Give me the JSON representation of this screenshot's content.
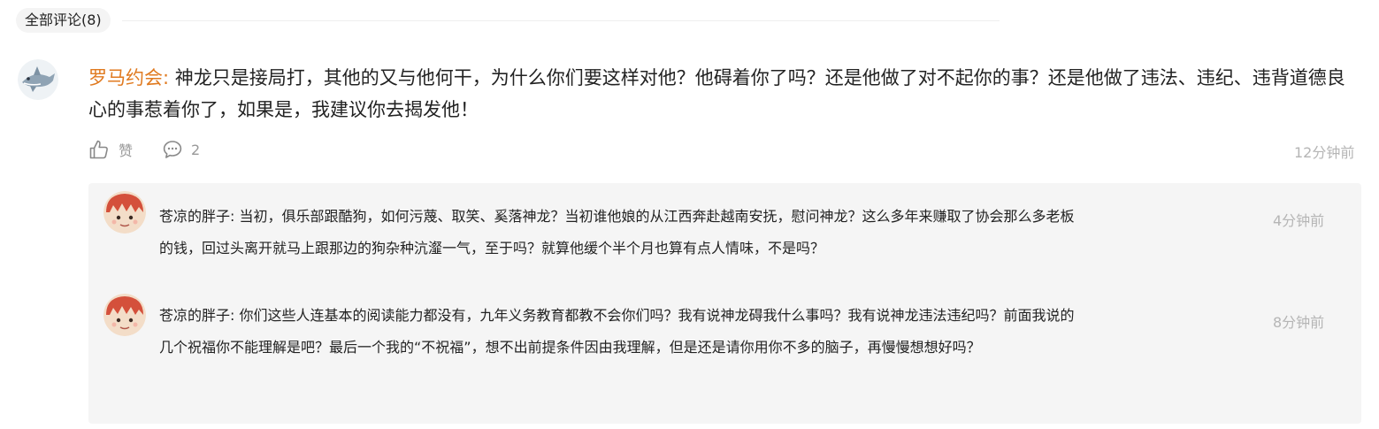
{
  "header": {
    "tab_label": "全部评论(8)"
  },
  "comment": {
    "author": "罗马约会",
    "separator": ": ",
    "text": "神龙只是接局打，其他的又与他何干，为什么你们要这样对他？他碍着你了吗？还是他做了对不起你的事？还是他做了违法、违纪、违背道德良心的事惹着你了，如果是，我建议你去揭发他！",
    "like_label": "赞",
    "reply_count": "2",
    "time": "12分钟前"
  },
  "replies": [
    {
      "author": "苍凉的胖子",
      "separator": ": ",
      "text": "当初，俱乐部跟酷狗，如何污蔑、取笑、奚落神龙？当初谁他娘的从江西奔赴越南安抚，慰问神龙？这么多年来赚取了协会那么多老板的钱，回过头离开就马上跟那边的狗杂种沆瀣一气，至于吗？就算他缓个半个月也算有点人情味，不是吗？",
      "time": "4分钟前"
    },
    {
      "author": "苍凉的胖子",
      "separator": ": ",
      "text": "你们这些人连基本的阅读能力都没有，九年义务教育都教不会你们吗？我有说神龙碍我什么事吗？我有说神龙违法违纪吗？前面我说的几个祝福你不能理解是吧？最后一个我的“不祝福”，想不出前提条件因由我理解，但是还是请你用你不多的脑子，再慢慢想想好吗？",
      "time": "8分钟前"
    }
  ],
  "colors": {
    "author": "#e07a20",
    "muted": "#999999",
    "time": "#b5b5b5",
    "reply_bg": "#f5f5f5"
  },
  "icons": {
    "like": "thumbs-up-icon",
    "reply": "chat-bubble-icon"
  }
}
